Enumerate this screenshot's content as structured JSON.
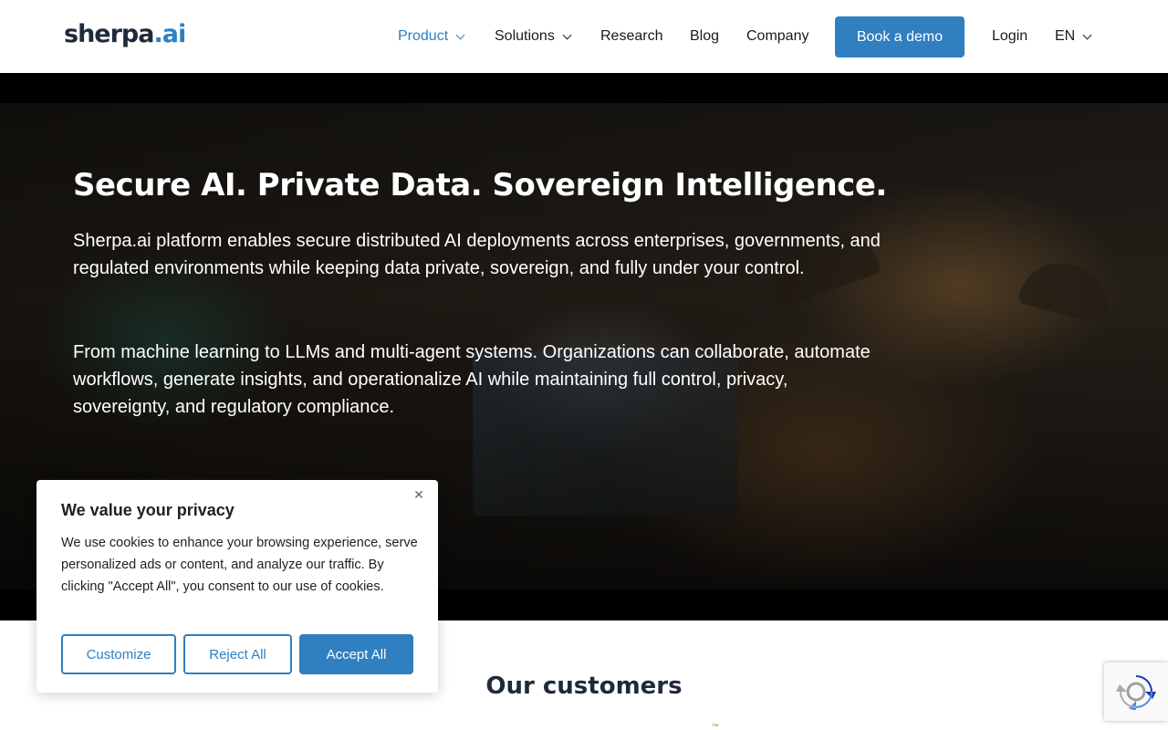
{
  "header": {
    "logo_main": "sherpa",
    "logo_suffix": ".ai",
    "nav": [
      {
        "label": "Product"
      },
      {
        "label": "Solutions"
      },
      {
        "label": "Research"
      },
      {
        "label": "Blog"
      },
      {
        "label": "Company"
      }
    ],
    "cta_label": "Book a demo",
    "login_label": "Login",
    "language": "EN"
  },
  "hero": {
    "title": "Secure AI. Private Data. Sovereign Intelligence.",
    "paragraph1": "Sherpa.ai platform enables secure distributed AI deployments across enterprises, governments, and regulated environments while keeping data private, sovereign, and fully under your control.",
    "paragraph2": "From machine learning to LLMs and multi-agent systems. Organizations can collaborate, automate workflows, generate insights, and operationalize AI while maintaining full control, privacy, sovereignty, and regulatory compliance."
  },
  "customers": {
    "title": "Our customers"
  },
  "cookie_banner": {
    "title": "We value your privacy",
    "text": "We use cookies to enhance your browsing experience, serve personalized ads or content, and analyze our traffic. By clicking \"Accept All\", you consent to our use of cookies.",
    "customize_label": "Customize",
    "reject_label": "Reject All",
    "accept_label": "Accept All",
    "close_glyph": "✕"
  },
  "icons": {
    "nav_dropdown": "chevron-down-icon",
    "cookie_close": "close-icon",
    "recaptcha": "recaptcha-icon"
  },
  "colors": {
    "accent": "#2f7fc1",
    "brand_dark": "#1e2a3a"
  }
}
